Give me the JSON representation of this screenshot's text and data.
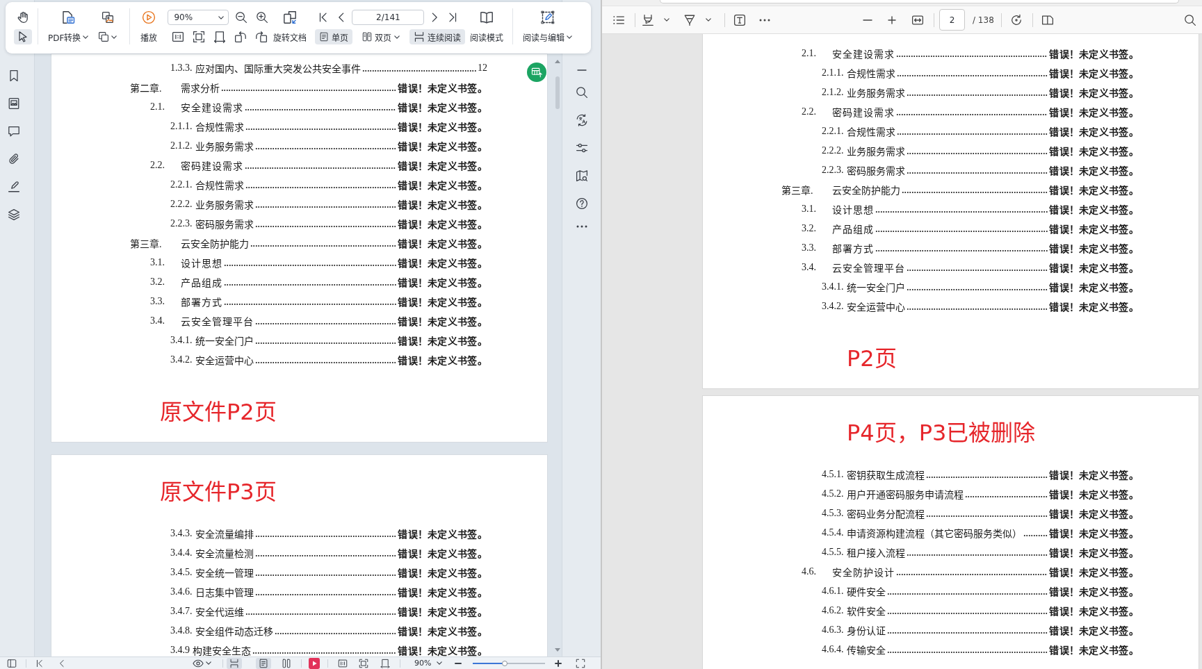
{
  "left_viewer": {
    "toolbar": {
      "tools": [
        {
          "kind": "hand",
          "selected": false
        },
        {
          "kind": "select",
          "selected": true
        }
      ],
      "pdf_convert": "PDF转换",
      "play": "播放",
      "zoom": "90%",
      "rotate_document": "旋转文档",
      "page": "2/141",
      "page_layouts": [
        {
          "label": "单页",
          "selected": true,
          "dropdown": false
        },
        {
          "label": "双页",
          "selected": false,
          "dropdown": true
        }
      ],
      "continuous_reading": {
        "label": "连续阅读",
        "on": true
      },
      "reading_mode": "阅读模式",
      "read_and_edit": "阅读与编辑"
    },
    "pages": [
      {
        "blocks": [
          {
            "kind": "toc",
            "entries": [
              {
                "kind": "subsection",
                "number": "1.3.3.",
                "title": "应对国内、国际重大突发公共安全事件",
                "page": "12"
              },
              {
                "kind": "chapter",
                "number": "第二章.",
                "title": "需求分析",
                "error": "错误！未定义书签。"
              },
              {
                "kind": "section",
                "number": "2.1.",
                "title": "安全建设需求",
                "error": "错误！未定义书签。"
              },
              {
                "kind": "subsection",
                "number": "2.1.1.",
                "title": "合规性需求",
                "error": "错误！未定义书签。"
              },
              {
                "kind": "subsection",
                "number": "2.1.2.",
                "title": "业务服务需求",
                "error": "错误！未定义书签。"
              },
              {
                "kind": "section",
                "number": "2.2.",
                "title": "密码建设需求",
                "error": "错误！未定义书签。"
              },
              {
                "kind": "subsection",
                "number": "2.2.1.",
                "title": "合规性需求",
                "error": "错误！未定义书签。"
              },
              {
                "kind": "subsection",
                "number": "2.2.2.",
                "title": "业务服务需求",
                "error": "错误！未定义书签。"
              },
              {
                "kind": "subsection",
                "number": "2.2.3.",
                "title": "密码服务需求",
                "error": "错误！未定义书签。"
              },
              {
                "kind": "chapter",
                "number": "第三章.",
                "title": "云安全防护能力",
                "error": "错误！未定义书签。"
              },
              {
                "kind": "section",
                "number": "3.1.",
                "title": "设计思想",
                "error": "错误！未定义书签。"
              },
              {
                "kind": "section",
                "number": "3.2.",
                "title": "产品组成",
                "error": "错误！未定义书签。"
              },
              {
                "kind": "section",
                "number": "3.3.",
                "title": "部署方式",
                "error": "错误！未定义书签。"
              },
              {
                "kind": "section",
                "number": "3.4.",
                "title": "云安全管理平台",
                "error": "错误！未定义书签。"
              },
              {
                "kind": "subsection",
                "number": "3.4.1.",
                "title": "统一安全门户",
                "error": "错误！未定义书签。"
              },
              {
                "kind": "subsection",
                "number": "3.4.2.",
                "title": "安全运营中心",
                "error": "错误！未定义书签。"
              }
            ]
          },
          {
            "kind": "note",
            "text": "原文件P2页"
          }
        ]
      },
      {
        "blocks": [
          {
            "kind": "note",
            "text": "原文件P3页"
          },
          {
            "kind": "toc",
            "entries": [
              {
                "kind": "subsection",
                "number": "3.4.3.",
                "title": "安全流量编排",
                "error": "错误！未定义书签。"
              },
              {
                "kind": "subsection",
                "number": "3.4.4.",
                "title": "安全流量检测",
                "error": "错误！未定义书签。"
              },
              {
                "kind": "subsection",
                "number": "3.4.5.",
                "title": "安全统一管理",
                "error": "错误！未定义书签。"
              },
              {
                "kind": "subsection",
                "number": "3.4.6.",
                "title": "日志集中管理",
                "error": "错误！未定义书签。"
              },
              {
                "kind": "subsection",
                "number": "3.4.7.",
                "title": "安全代运维",
                "error": "错误！未定义书签。"
              },
              {
                "kind": "subsection",
                "number": "3.4.8.",
                "title": "安全组件动态迁移",
                "error": "错误！未定义书签。"
              },
              {
                "kind": "subsection",
                "number": "3.4.9",
                "title": "构建安全生态",
                "error": "错误！未定义书签。"
              }
            ]
          }
        ]
      }
    ],
    "status_bar": {
      "view_buttons": [
        {
          "kind": "continuous",
          "on": true
        },
        {
          "kind": "single",
          "on": true
        },
        {
          "kind": "double",
          "on": false
        }
      ],
      "zoom": "90%",
      "zoom_slider": {
        "level": 0.44
      }
    }
  },
  "right_viewer": {
    "toolbar": {
      "page": "2",
      "page_total": "/ 138"
    },
    "pages": [
      {
        "blocks": [
          {
            "kind": "toc",
            "entries": [
              {
                "kind": "section",
                "number": "2.1.",
                "title": "安全建设需求",
                "error": "错误！未定义书签。"
              },
              {
                "kind": "subsection",
                "number": "2.1.1.",
                "title": "合规性需求",
                "error": "错误！未定义书签。"
              },
              {
                "kind": "subsection",
                "number": "2.1.2.",
                "title": "业务服务需求",
                "error": "错误！未定义书签。"
              },
              {
                "kind": "section",
                "number": "2.2.",
                "title": "密码建设需求",
                "error": "错误！未定义书签。"
              },
              {
                "kind": "subsection",
                "number": "2.2.1.",
                "title": "合规性需求",
                "error": "错误！未定义书签。"
              },
              {
                "kind": "subsection",
                "number": "2.2.2.",
                "title": "业务服务需求",
                "error": "错误！未定义书签。"
              },
              {
                "kind": "subsection",
                "number": "2.2.3.",
                "title": "密码服务需求",
                "error": "错误！未定义书签。"
              },
              {
                "kind": "chapter",
                "number": "第三章.",
                "title": "云安全防护能力",
                "error": "错误！未定义书签。"
              },
              {
                "kind": "section",
                "number": "3.1.",
                "title": "设计思想",
                "error": "错误！未定义书签。"
              },
              {
                "kind": "section",
                "number": "3.2.",
                "title": "产品组成",
                "error": "错误！未定义书签。"
              },
              {
                "kind": "section",
                "number": "3.3.",
                "title": "部署方式",
                "error": "错误！未定义书签。"
              },
              {
                "kind": "section",
                "number": "3.4.",
                "title": "云安全管理平台",
                "error": "错误！未定义书签。"
              },
              {
                "kind": "subsection",
                "number": "3.4.1.",
                "title": "统一安全门户",
                "error": "错误！未定义书签。"
              },
              {
                "kind": "subsection",
                "number": "3.4.2.",
                "title": "安全运营中心",
                "error": "错误！未定义书签。"
              }
            ]
          },
          {
            "kind": "note",
            "text": "P2页"
          }
        ]
      },
      {
        "blocks": [
          {
            "kind": "note",
            "text": "P4页，P3已被删除"
          },
          {
            "kind": "toc",
            "entries": [
              {
                "kind": "subsection",
                "number": "4.5.1.",
                "title": "密钥获取生成流程",
                "error": "错误！未定义书签。"
              },
              {
                "kind": "subsection",
                "number": "4.5.2.",
                "title": "用户开通密码服务申请流程",
                "error": "错误！未定义书签。"
              },
              {
                "kind": "subsection",
                "number": "4.5.3.",
                "title": "密码业务分配流程",
                "error": "错误！未定义书签。"
              },
              {
                "kind": "subsection",
                "number": "4.5.4.",
                "title": "申请资源构建流程（其它密码服务类似）",
                "error": "错误！未定义书签。"
              },
              {
                "kind": "subsection",
                "number": "4.5.5.",
                "title": "租户接入流程",
                "error": "错误！未定义书签。"
              },
              {
                "kind": "section",
                "number": "4.6.",
                "title": "安全防护设计",
                "error": "错误！未定义书签。"
              },
              {
                "kind": "subsection",
                "number": "4.6.1.",
                "title": "硬件安全",
                "error": "错误！未定义书签。"
              },
              {
                "kind": "subsection",
                "number": "4.6.2.",
                "title": "软件安全",
                "error": "错误！未定义书签。"
              },
              {
                "kind": "subsection",
                "number": "4.6.3.",
                "title": "身份认证",
                "error": "错误！未定义书签。"
              },
              {
                "kind": "subsection",
                "number": "4.6.4.",
                "title": "传输安全",
                "error": "错误！未定义书签。"
              }
            ]
          }
        ]
      }
    ]
  }
}
